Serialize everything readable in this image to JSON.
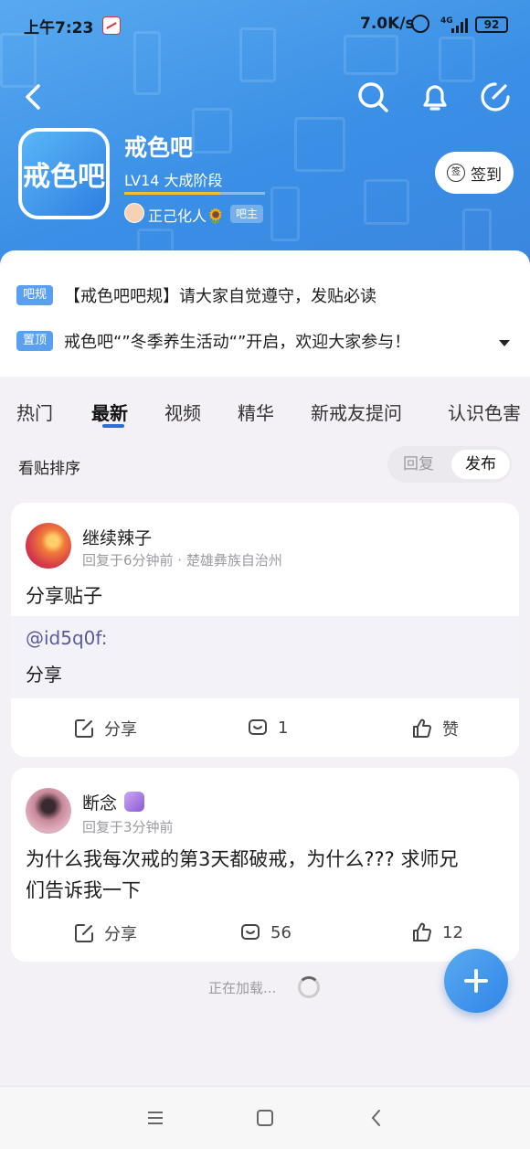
{
  "status_bar": {
    "time": "上午7:23",
    "speed": "7.0K/s",
    "network": "4G",
    "battery": "92"
  },
  "header": {
    "forum_name": "戒色吧",
    "avatar_text": "戒色吧",
    "level": "LV14  大成阶段",
    "level_progress": 0.68,
    "owner_name": "正己化人🌻",
    "owner_badge": "吧主",
    "sign_button": "签到",
    "sign_icon_text": "签"
  },
  "notices": [
    {
      "tag": "吧规",
      "text": "【戒色吧吧规】请大家自觉遵守，发贴必读"
    },
    {
      "tag": "置顶",
      "text": "戒色吧“”冬季养生活动“”开启，欢迎大家参与！"
    }
  ],
  "tabs": [
    "热门",
    "最新",
    "视频",
    "精华",
    "新戒友提问",
    "认识色害"
  ],
  "active_tab": "最新",
  "sort": {
    "label": "看贴排序",
    "options": [
      "回复",
      "发布"
    ],
    "selected": "发布"
  },
  "posts": [
    {
      "username": "继续辣子",
      "meta": "回复于6分钟前  ·  楚雄彝族自治州",
      "title": "分享贴子",
      "quote_at": "@id5q0f:",
      "quote_text": "分享",
      "share_label": "分享",
      "comments": "1",
      "likes": "赞"
    },
    {
      "username": "断念",
      "meta": "回复于3分钟前",
      "title_line1": "为什么我每次戒的第3天都破戒，为什么??? 求师兄",
      "title_line2": "们告诉我一下",
      "share_label": "分享",
      "comments": "56",
      "likes": "12"
    }
  ],
  "loading_text": "正在加载...",
  "colors": {
    "accent": "#2b6fd6",
    "header": "#3a8fe6",
    "tag": "#5aa0ee"
  }
}
